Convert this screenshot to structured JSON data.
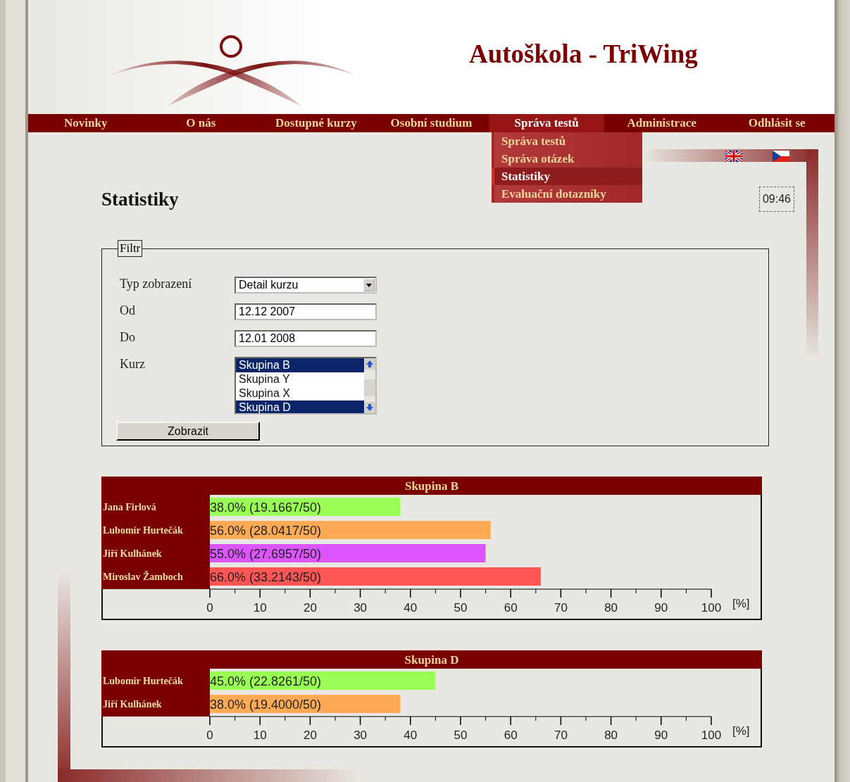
{
  "header": {
    "title": "Autoškola - TriWing"
  },
  "nav": [
    {
      "label": "Novinky",
      "selected": false
    },
    {
      "label": "O nás",
      "selected": false
    },
    {
      "label": "Dostupné kurzy",
      "selected": false
    },
    {
      "label": "Osobní studium",
      "selected": false
    },
    {
      "label": "Správa testů",
      "selected": true
    },
    {
      "label": "Administrace",
      "selected": false
    },
    {
      "label": "Odhlásit se",
      "selected": false
    }
  ],
  "submenu": [
    {
      "label": "Správa testů",
      "selected": false
    },
    {
      "label": "Správa otázek",
      "selected": false
    },
    {
      "label": "Statistiky",
      "selected": true
    },
    {
      "label": "Evaluační dotazníky",
      "selected": false
    }
  ],
  "page_title": "Statistiky",
  "clock": "09:46",
  "filter": {
    "legend": "Filtr",
    "type_label": "Typ zobrazení",
    "type_value": "Detail kurzu",
    "from_label": "Od",
    "from_value": "12.12 2007",
    "to_label": "Do",
    "to_value": "12.01 2008",
    "course_label": "Kurz",
    "courses": [
      {
        "label": "Skupina B",
        "selected": true
      },
      {
        "label": "Skupina Y",
        "selected": false
      },
      {
        "label": "Skupina X",
        "selected": false
      },
      {
        "label": "Skupina D",
        "selected": true
      }
    ],
    "submit": "Zobrazit"
  },
  "charts": [
    {
      "chart_data": {
        "type": "bar",
        "orientation": "horizontal",
        "title": "Skupina B",
        "xlabel": "[%]",
        "categories": [
          "Jana Firlová",
          "Lubomír Hurtečák",
          "Jiří Kulhánek",
          "Miroslav Žamboch"
        ],
        "values": [
          38.0,
          56.0,
          55.0,
          66.0
        ],
        "colors": [
          "#99ff55",
          "#ffaa55",
          "#dd55ff",
          "#ff5555"
        ],
        "value_labels": [
          "38.0% (19.1667/50)",
          "56.0% (28.0417/50)",
          "55.0% (27.6957/50)",
          "66.0% (33.2143/50)"
        ],
        "xlim": [
          0,
          100
        ],
        "xticks": [
          0,
          10,
          20,
          30,
          40,
          50,
          60,
          70,
          80,
          90,
          100
        ]
      }
    },
    {
      "chart_data": {
        "type": "bar",
        "orientation": "horizontal",
        "title": "Skupina D",
        "xlabel": "[%]",
        "categories": [
          "Lubomír Hurtečák",
          "Jiří Kulhánek"
        ],
        "values": [
          45.0,
          38.0
        ],
        "colors": [
          "#99ff55",
          "#ffaa55"
        ],
        "value_labels": [
          "45.0% (22.8261/50)",
          "38.0% (19.4000/50)"
        ],
        "xlim": [
          0,
          100
        ],
        "xticks": [
          0,
          10,
          20,
          30,
          40,
          50,
          60,
          70,
          80,
          90,
          100
        ]
      }
    }
  ]
}
